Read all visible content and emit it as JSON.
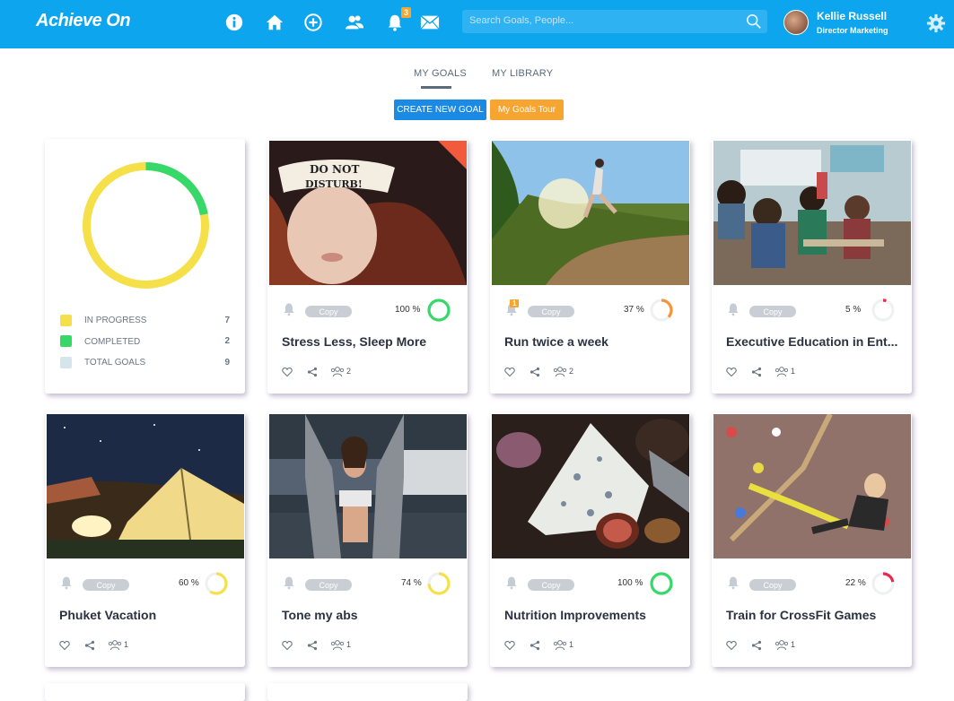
{
  "app": {
    "logo": "Achieve On"
  },
  "header": {
    "notifications_count": "3",
    "search_placeholder": "Search Goals, People...",
    "user_name": "Kellie Russell",
    "user_role": "Director Marketing"
  },
  "tabs": [
    {
      "label": "MY GOALS"
    },
    {
      "label": "MY LIBRARY"
    }
  ],
  "actions": {
    "create_label": "CREATE NEW GOAL",
    "tour_label": "My Goals Tour"
  },
  "summary": {
    "progress_fraction": 0.22,
    "legend": [
      {
        "label": "IN PROGRESS",
        "value": "7",
        "color": "#f5e04a"
      },
      {
        "label": "COMPLETED",
        "value": "2",
        "color": "#36d86a"
      },
      {
        "label": "TOTAL GOALS",
        "value": "9",
        "color": "#d6e4ec"
      }
    ]
  },
  "goals": [
    {
      "title": "Stress Less, Sleep More",
      "percent_label": "100 %",
      "percent": 100,
      "ring_color": "#36d86a",
      "copy_label": "Copy",
      "members": "2",
      "image": "sleep-mask",
      "notice": ""
    },
    {
      "title": "Run twice a week",
      "percent_label": "37 %",
      "percent": 37,
      "ring_color": "#f7943a",
      "copy_label": "Copy",
      "members": "2",
      "image": "runner",
      "notice": "1"
    },
    {
      "title": "Executive Education in Ent...",
      "percent_label": "5 %",
      "percent": 5,
      "ring_color": "#e8284d",
      "copy_label": "Copy",
      "members": "1",
      "image": "classroom",
      "notice": ""
    },
    {
      "title": "Phuket Vacation",
      "percent_label": "60 %",
      "percent": 60,
      "ring_color": "#f5e04a",
      "copy_label": "Copy",
      "members": "1",
      "image": "tent",
      "notice": ""
    },
    {
      "title": "Tone my abs",
      "percent_label": "74 %",
      "percent": 74,
      "ring_color": "#f5e04a",
      "copy_label": "Copy",
      "members": "1",
      "image": "fitness",
      "notice": ""
    },
    {
      "title": "Nutrition Improvements",
      "percent_label": "100 %",
      "percent": 100,
      "ring_color": "#36d86a",
      "copy_label": "Copy",
      "members": "1",
      "image": "cheese",
      "notice": ""
    },
    {
      "title": "Train for CrossFit Games",
      "percent_label": "22 %",
      "percent": 22,
      "ring_color": "#e8284d",
      "copy_label": "Copy",
      "members": "1",
      "image": "rope-climb",
      "notice": ""
    }
  ]
}
